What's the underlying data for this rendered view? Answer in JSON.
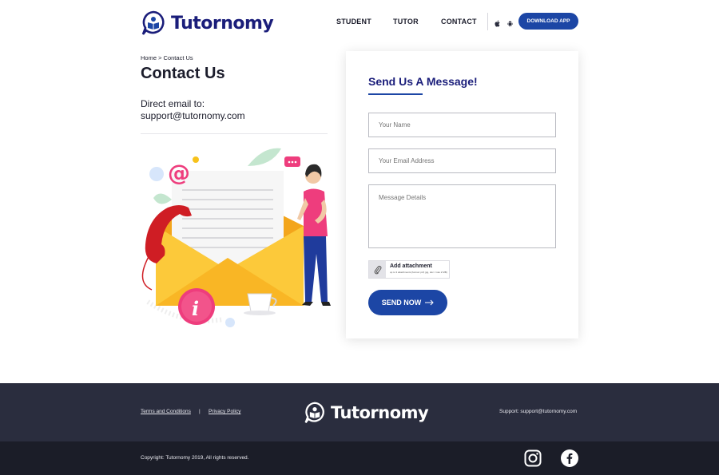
{
  "brand": {
    "name": "Tutornomy",
    "primary_color": "#1c46a5",
    "dark_color": "#1a1d7a"
  },
  "nav": {
    "items": [
      "STUDENT",
      "TUTOR",
      "CONTACT"
    ],
    "store_icons": [
      "apple-icon",
      "android-icon"
    ],
    "cta_label": "DOWNLOAD APP"
  },
  "left": {
    "breadcrumb": "Home > Contact Us",
    "title": "Contact Us",
    "direct_label": "Direct email to:",
    "direct_email": "support@tutornomy.com"
  },
  "form": {
    "title": "Send Us A Message!",
    "name_placeholder": "Your Name",
    "email_placeholder": "Your Email Address",
    "message_placeholder": "Message Details",
    "attach_label": "Add attachment",
    "attach_note": "up to 3 attachments (format: pdf, jpg, doc / max 2 MB)",
    "send_label": "SEND NOW"
  },
  "footer": {
    "links": [
      "Terms and Conditions",
      "Privacy Policy"
    ],
    "separator": "|",
    "support": "Support: support@tutornomy.com",
    "copyright": "Copyright: Tutornomy 2019, All rights reserved.",
    "social": [
      "instagram-icon",
      "facebook-icon"
    ],
    "bg_top": "#2a2d3e",
    "bg_bottom": "#1b1d28"
  }
}
